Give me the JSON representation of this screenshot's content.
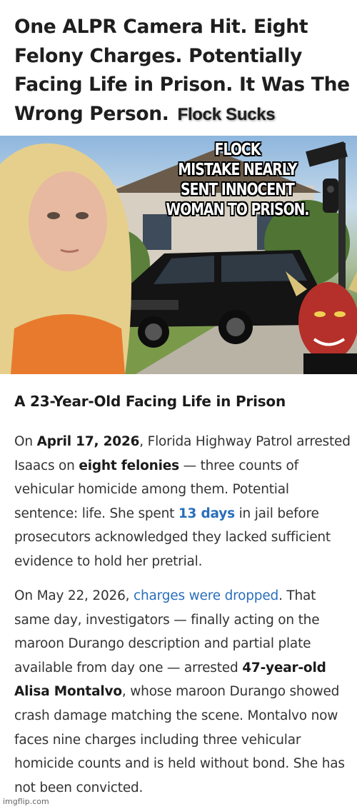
{
  "headline": {
    "text": "One ALPR Camera Hit. Eight Felony Charges. Potentially Facing Life in Prison. It Was The Wrong Person.",
    "tag": "Flock Sucks"
  },
  "illustration": {
    "overlay_text": "FLOCK\nMISTAKE NEARLY\nSENT INNOCENT\nWOMAN TO PRISON."
  },
  "article": {
    "heading": "A 23-Year-Old Facing Life in Prison",
    "p1": {
      "t1": "On ",
      "date": "April 17, 2026",
      "t2": ", Florida Highway Patrol arrested Isaacs on ",
      "felonies": "eight felonies",
      "t3": " — three counts of vehicular homicide among them. Potential sentence: life. She spent ",
      "days": "13 days",
      "t4": " in jail before prosecutors acknowledged they lacked sufficient evidence to hold her pretrial."
    },
    "p2": {
      "t1": "On May 22, 2026, ",
      "link": "charges were dropped",
      "t2": ". That same day, investigators — finally acting on the maroon Durango description and partial plate available from day one — arrested ",
      "suspect": "47-year-old Alisa Montalvo",
      "t3": ", whose maroon Durango showed crash damage matching the scene. Montalvo now faces nine charges including three vehicular homicide counts and is held without bond. She has not been convicted."
    }
  },
  "watermark": "imgflip.com",
  "colors": {
    "link": "#2a6ebb",
    "text": "#333333",
    "heading": "#1b1b1b"
  }
}
